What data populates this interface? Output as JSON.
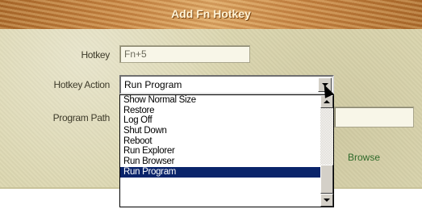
{
  "dialog": {
    "title": "Add Fn Hotkey"
  },
  "form": {
    "hotkey_label": "Hotkey",
    "hotkey_value": "Fn+5",
    "action_label": "Hotkey Action",
    "action_selected": "Run Program",
    "path_label": "Program Path",
    "path_value": "",
    "browse_label": "Browse"
  },
  "dropdown": {
    "items": [
      "Show Normal Size",
      "Restore",
      "Log Off",
      "Shut Down",
      "Reboot",
      "Run Explorer",
      "Run Browser",
      "Run Program"
    ],
    "selected_index": 7
  },
  "colors": {
    "title_bar": "#c58343",
    "panel_background": "#ddd8b2",
    "selection": "#0a246a",
    "browse_link": "#2e6a2a"
  }
}
